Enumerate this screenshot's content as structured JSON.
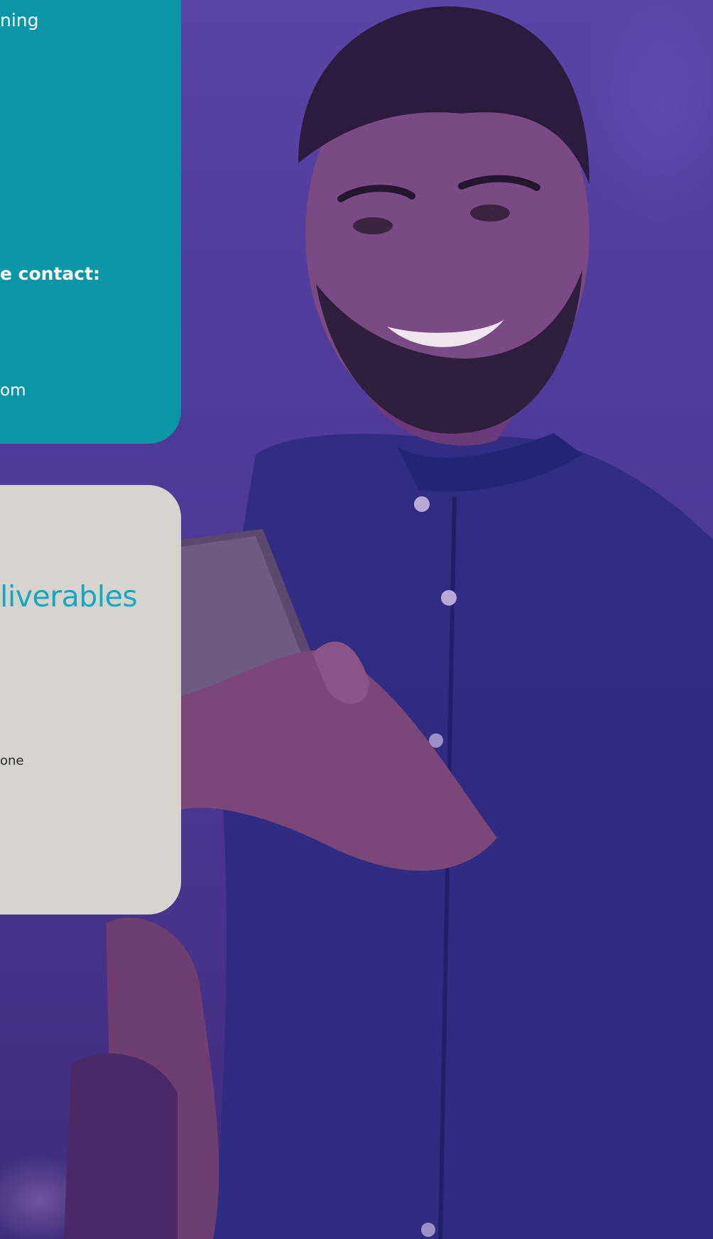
{
  "teal_card": {
    "line_top": "ning",
    "line_contact": "e contact:",
    "line_email": "om"
  },
  "grey_card": {
    "heading": "liverables",
    "line_text": "one"
  },
  "colors": {
    "teal": "#0b96a8",
    "grey": "#d6d2cd",
    "accent_heading": "#12a9c0",
    "overlay_purple": "#4e3a98"
  }
}
